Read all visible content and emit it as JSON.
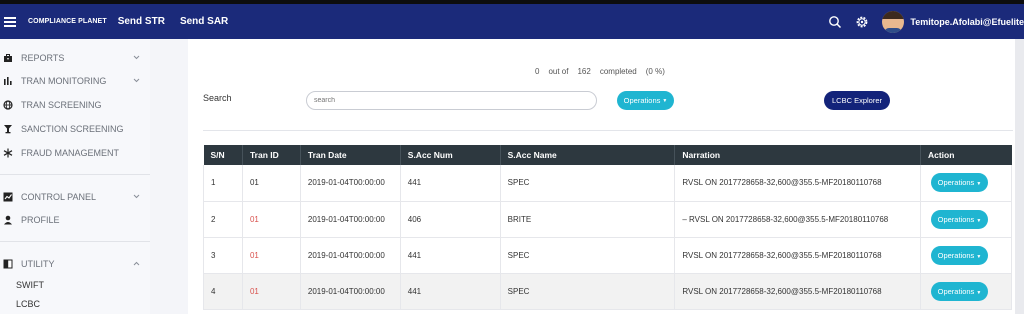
{
  "navbar": {
    "brand": "COMPLIANCE PLANET",
    "links": [
      "Send STR",
      "Send SAR"
    ],
    "username": "Temitope.Afolabi@Efuelite"
  },
  "sidebar": {
    "items": [
      {
        "label": "REPORTS",
        "icon": "briefcase-icon",
        "has_chevron": true,
        "chevron": "down"
      },
      {
        "label": "TRAN MONITORING",
        "icon": "bar-chart-icon",
        "has_chevron": true,
        "chevron": "down"
      },
      {
        "label": "TRAN SCREENING",
        "icon": "globe-icon",
        "has_chevron": false
      },
      {
        "label": "SANCTION SCREENING",
        "icon": "gavel-icon",
        "has_chevron": false
      },
      {
        "label": "FRAUD MANAGEMENT",
        "icon": "snowflake-icon",
        "has_chevron": false
      },
      {
        "label": "CONTROL PANEL",
        "icon": "chart-box-icon",
        "has_chevron": true,
        "chevron": "down"
      },
      {
        "label": "PROFILE",
        "icon": "user-icon",
        "has_chevron": false
      },
      {
        "label": "UTILITY",
        "icon": "columns-icon",
        "has_chevron": true,
        "chevron": "up"
      }
    ],
    "utility_sub": [
      "SWIFT",
      "LCBC"
    ]
  },
  "stats": {
    "completed_count": "0",
    "out_of": "out of",
    "total": "162",
    "completed_label": "completed",
    "percent": "(0 %)"
  },
  "search": {
    "label": "Search",
    "placeholder": "search"
  },
  "buttons": {
    "operations": "Operations",
    "lcbc_explorer": "LCBC Explorer"
  },
  "table": {
    "headers": [
      "S/N",
      "Tran ID",
      "Tran Date",
      "S.Acc Num",
      "S.Acc Name",
      "Narration",
      "Action"
    ],
    "rows": [
      {
        "sn": "1",
        "tran_id": "01",
        "tran_date": "2019-01-04T00:00:00",
        "acc_num": "441",
        "acc_name": "SPEC",
        "narration": "RVSL ON 2017728658-32,600@355.5-MF20180110768",
        "action": "Operations"
      },
      {
        "sn": "2",
        "tran_id": "01",
        "tran_date": "2019-01-04T00:00:00",
        "acc_num": "406",
        "acc_name": "BRITE",
        "narration": "– RVSL ON 2017728658-32,600@355.5-MF20180110768",
        "action": "Operations"
      },
      {
        "sn": "3",
        "tran_id": "01",
        "tran_date": "2019-01-04T00:00:00",
        "acc_num": "441",
        "acc_name": "SPEC",
        "narration": "RVSL ON 2017728658-32,600@355.5-MF20180110768",
        "action": "Operations"
      },
      {
        "sn": "4",
        "tran_id": "01",
        "tran_date": "2019-01-04T00:00:00",
        "acc_num": "441",
        "acc_name": "SPEC",
        "narration": "RVSL ON 2017728658-32,600@355.5-MF20180110768",
        "action": "Operations"
      }
    ]
  },
  "colors": {
    "navbar": "#1b2a7a",
    "accent": "#1fb5d1",
    "lcbc_button": "#13237a",
    "table_header": "#2d383f",
    "red_id": "#d9534f"
  }
}
